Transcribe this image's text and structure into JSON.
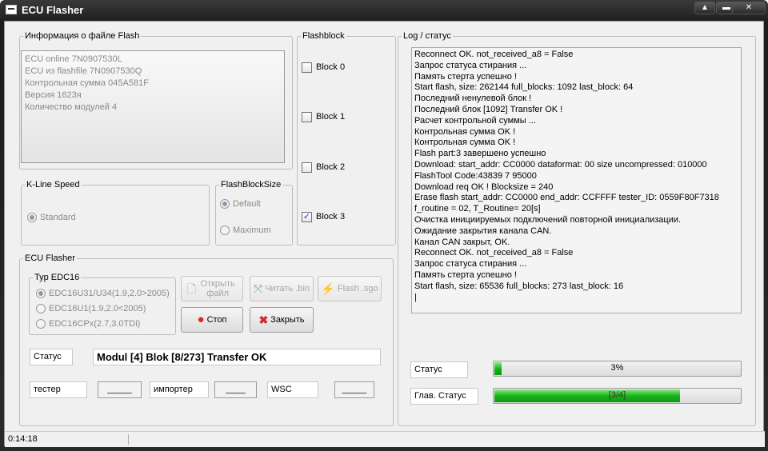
{
  "window": {
    "title": "ECU Flasher",
    "buttons": [
      "▲",
      "▬",
      "✕"
    ]
  },
  "info": {
    "legend": "Информация  о файле Flash",
    "lines": [
      "ECU online 7N0907530L",
      "ECU из flashfile 7N0907530Q",
      "Контрольная сумма 045A581F",
      "Версия 1623я",
      "Количество модулей 4"
    ]
  },
  "flashblock": {
    "legend": "Flashblock",
    "blocks": [
      {
        "label": "Block 0",
        "checked": false
      },
      {
        "label": "Block 1",
        "checked": false
      },
      {
        "label": "Block 2",
        "checked": false
      },
      {
        "label": "Block 3",
        "checked": true
      }
    ]
  },
  "kline": {
    "legend": "K-Line Speed",
    "option": "Standard"
  },
  "blocksize": {
    "legend": "FlashBlockSize",
    "options": [
      "Default",
      "Maximum"
    ],
    "selected": "Default"
  },
  "ecu_flasher": {
    "legend": "ECU Flasher",
    "typ": {
      "legend": "Typ EDC16",
      "options": [
        "EDC16U31/U34(1.9,2.0>2005)",
        "EDC16U1(1.9,2.0<2005)",
        "EDC16CPx(2.7,3.0TDi)"
      ],
      "selected": 0
    },
    "buttons": {
      "open": "Открыть файл",
      "read": "Читать .bin",
      "flash": "Flash .sgo",
      "stop": "Стоп",
      "close": "Закрыть"
    },
    "status_label": "Статус",
    "status_value": "Modul [4] Blok [8/273] Transfer OK",
    "fields": [
      {
        "label": "тестер",
        "value": "_____"
      },
      {
        "label": "импортер",
        "value": "____"
      },
      {
        "label": "WSC",
        "value": "_____"
      }
    ]
  },
  "log": {
    "legend": "Log / статус",
    "lines": [
      "Reconnect OK. not_received_a8 = False",
      "Запрос статуса стирания ...",
      "Память стерта успешно !",
      "Start flash, size: 262144 full_blocks: 1092 last_block: 64",
      "Последний ненулевой блок !",
      "Последний блок [1092] Transfer OK !",
      "Расчет контрольной суммы ...",
      "Контрольная сумма OK !",
      "Контрольная сумма OK !",
      "Flash part:3 завершено успешно",
      "Download: start_addr: CC0000 dataformat: 00 size uncompressed: 010000",
      "FlashTool Code:43839 7 95000",
      "Download req OK ! Blocksize = 240",
      "Erase flash start_addr: CC0000 end_addr: CCFFFF tester_ID: 0559F80F7318",
      "f_routine = 02, T_Routine= 20[s]",
      "Очистка инициируемых подключений повторной инициализации.",
      "Ожидание закрытия канала CAN.",
      "Канал CAN закрыт, OK.",
      "Reconnect OK. not_received_a8 = False",
      "Запрос статуса стирания ...",
      "Память стерта успешно !",
      "Start flash, size: 65536 full_blocks: 273 last_block: 16",
      "|"
    ]
  },
  "progress": {
    "status_label": "Статус",
    "status_text": "3%",
    "status_fraction": 0.03,
    "main_label": "Глав. Статус",
    "main_text": "[3/4]",
    "main_fraction": 0.75
  },
  "statusbar": {
    "time": "0:14:18"
  },
  "colors": {
    "progress_green": "#1ab21a",
    "title_bg": "#1b1b1b",
    "panel_bg": "#f0f0f0"
  }
}
